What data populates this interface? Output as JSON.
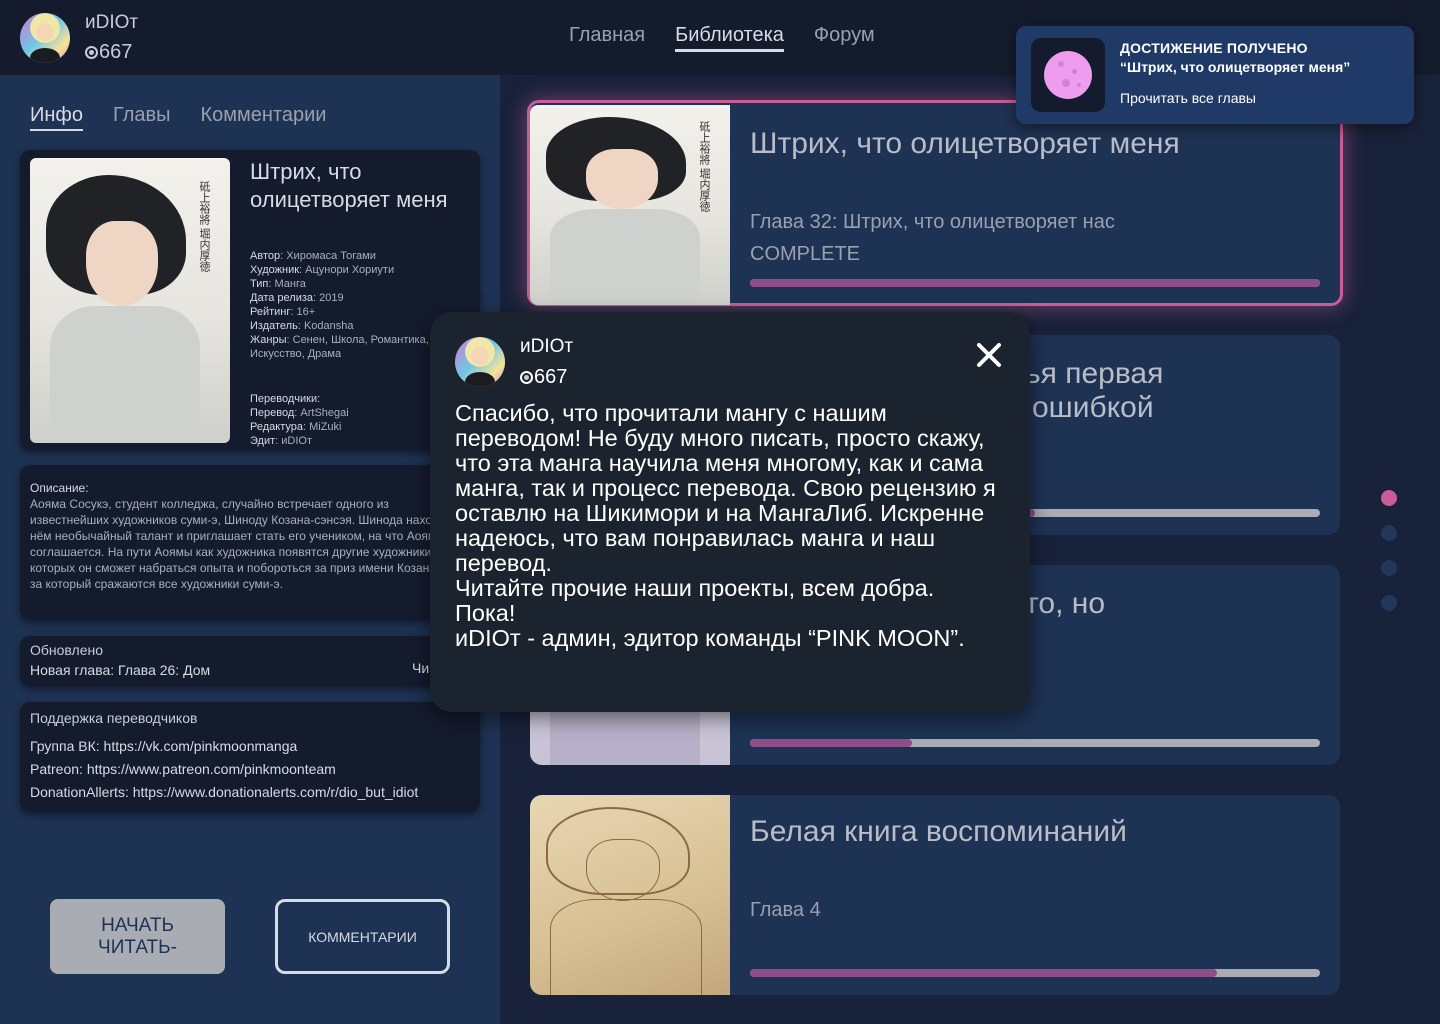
{
  "user": {
    "name": "иDIOт",
    "points": "667"
  },
  "nav": [
    {
      "label": "Главная",
      "active": false
    },
    {
      "label": "Библиотека",
      "active": true
    },
    {
      "label": "Форум",
      "active": false
    }
  ],
  "tabs": [
    {
      "label": "Инфо",
      "active": true
    },
    {
      "label": "Главы",
      "active": false
    },
    {
      "label": "Комментарии",
      "active": false
    }
  ],
  "manga": {
    "title": "Штрих, что олицетворяет меня",
    "cover_text": "砥上裕將 堀内厚徳",
    "meta": [
      {
        "key": "Автор",
        "value": "Хиромаса Тогами"
      },
      {
        "key": "Художник",
        "value": "Ацунори Хориути"
      },
      {
        "key": "Тип",
        "value": "Манга"
      },
      {
        "key": "Дата релиза",
        "value": "2019"
      },
      {
        "key": "Рейтинг",
        "value": "16+"
      },
      {
        "key": "Издатель",
        "value": "Kodansha"
      },
      {
        "key": "Жанры",
        "value": "Сенен, Школа, Романтика, Искусство, Драма"
      }
    ],
    "translators_label": "Переводчики:",
    "translators": [
      {
        "key": "Перевод",
        "value": "ArtShegai"
      },
      {
        "key": "Редактура",
        "value": "MiZuki"
      },
      {
        "key": "Эдит",
        "value": "иDIOт"
      }
    ],
    "description_label": "Описание:",
    "description": "Аояма Сосукэ, студент колледжа, случайно встречает одного из известнейших художников суми-э, Шиноду Козана-сэнсэя. Шинода находит в нём необычайный талант и приглашает стать его учеником, на что Аояма соглашается. На пути Аоямы как художника появятся другие художники, у которых он сможет набраться опыта и побороться за приз имени Козана, приз за который сражаются все художники суми-э."
  },
  "updated": {
    "title": "Обновлено",
    "text": "Новая глава: Глава 26: Дом",
    "right": "Чи"
  },
  "support": {
    "title": "Поддержка переводчиков",
    "links": [
      "Группа ВК: https://vk.com/pinkmoonmanga",
      "Patreon: https://www.patreon.com/pinkmoonteam",
      "DonationAllerts: https://www.donationalerts.com/r/dio_but_idiot"
    ]
  },
  "buttons": {
    "start": "НАЧАТЬ ЧИТАТЬ-",
    "comments": "КОММЕНТАРИИ"
  },
  "chapters": [
    {
      "title": "Штрих, что олицетворяет меня",
      "subtitle": "Глава 32: Штрих, что олицетворяет нас",
      "status": "COMPLETE",
      "progress": 1.0
    },
    {
      "title": "ья первая",
      "title2": "ошибкой",
      "progress": 0.5
    },
    {
      "title": "то, но",
      "progress": 0.285
    },
    {
      "title": "Белая книга воспоминаний",
      "subtitle": "Глава 4",
      "progress": 0.82
    }
  ],
  "carousel": {
    "count": 4,
    "active": 0
  },
  "achievement": {
    "heading": "ДОСТИЖЕНИЕ ПОЛУЧЕНО",
    "name": "“Штрих, что олицетворяет меня”",
    "desc": "Прочитать все главы"
  },
  "modal": {
    "name": "иDIOт",
    "points": "667",
    "message": [
      "Спасибо, что прочитали мангу с нашим переводом! Не буду много писать, просто скажу, что эта манга научила меня многому, как и сама манга, так и процесс перевода. Свою рецензию я оставлю на Шикимори и на МангаЛиб. Искренне надеюсь, что вам понравилась манга и наш перевод.",
      "Читайте прочие наши проекты, всем добра.",
      "Пока!",
      "иDIOт - админ, эдитор команды “PINK MOON”."
    ]
  },
  "colors": {
    "accent": "#c85d97",
    "panel": "#1e3253",
    "dark": "#141b2d",
    "background": "#18223a"
  }
}
